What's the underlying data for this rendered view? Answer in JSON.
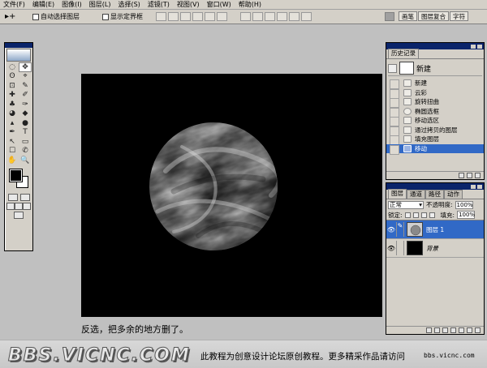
{
  "menu": [
    "文件(F)",
    "编辑(E)",
    "图像(I)",
    "图层(L)",
    "选择(S)",
    "滤镜(T)",
    "视图(V)",
    "窗口(W)",
    "帮助(H)"
  ],
  "options": {
    "tool_glyph": "▸+",
    "auto_select_label": "自动选择图层",
    "show_bounds_label": "显示定界框",
    "dock_tabs": [
      "画笔",
      "图层复合",
      "字符"
    ]
  },
  "toolbox": {
    "tools": [
      "◌",
      "✥",
      "ʘ",
      "⌖",
      "⊡",
      "✎",
      "✚",
      "✐",
      "♣",
      "✑",
      "◕",
      "◆",
      "▴",
      "●",
      "✒",
      "T",
      "↖",
      "▭",
      "☐",
      "✆",
      "✋",
      "🔍"
    ]
  },
  "history": {
    "tabs": [
      "历史记录"
    ],
    "snapshot": "新建",
    "items": [
      "新建",
      "云彩",
      "旋转扭曲",
      "椭圆选框",
      "移动选区",
      "通过拷贝的图层",
      "填充图层",
      "移动"
    ],
    "selected_index": 7
  },
  "layers": {
    "tabs": [
      "图层",
      "通道",
      "路径",
      "动作"
    ],
    "blend_mode": "正常",
    "opacity_label": "不透明度:",
    "opacity_value": "100%",
    "lock_label": "锁定:",
    "fill_label": "填充:",
    "fill_value": "100%",
    "rows": [
      {
        "name": "图层 1",
        "selected": true
      },
      {
        "name": "背景",
        "selected": false
      }
    ]
  },
  "caption": "反选，把多余的地方删了。",
  "footer": {
    "logo": "BBS.VICNC.COM",
    "text": "此教程为创意设计论坛原创教程。更多精采作品请访问",
    "url": "bbs.vicnc.com"
  },
  "colors": {
    "title_bar": "#0a246a",
    "selection": "#3169c6",
    "chrome": "#d4d0c8",
    "workspace": "#c0c0c0"
  }
}
